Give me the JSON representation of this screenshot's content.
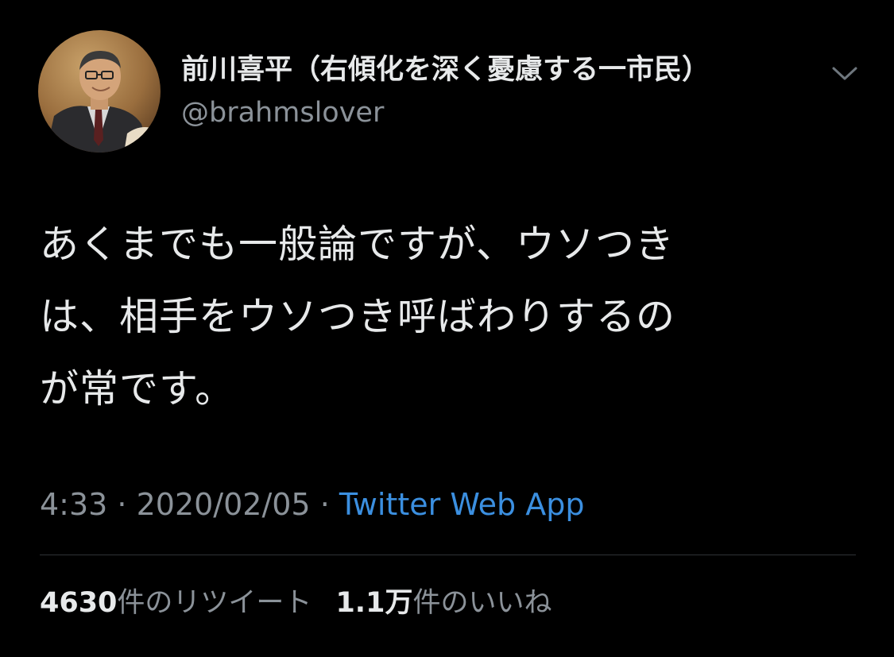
{
  "author": {
    "display_name": "前川喜平（右傾化を深く憂慮する一市民）",
    "handle": "@brahmslover"
  },
  "tweet": {
    "lines": [
      "あくまでも一般論ですが、ウソつき",
      "は、相手をウソつき呼ばわりするの",
      "が常です。"
    ],
    "time": "4:33",
    "date": "2020/02/05",
    "separator": " · ",
    "source": "Twitter Web App"
  },
  "stats": {
    "retweets_count": "4630",
    "retweets_label": "件のリツイート",
    "likes_count": "1.1万",
    "likes_label": "件のいいね"
  },
  "icons": {
    "menu": "chevron-down-icon"
  },
  "colors": {
    "background": "#000000",
    "text": "#e7e9ea",
    "secondary": "#8b9299",
    "link": "#3b8fe0",
    "divider": "#2f3336"
  }
}
